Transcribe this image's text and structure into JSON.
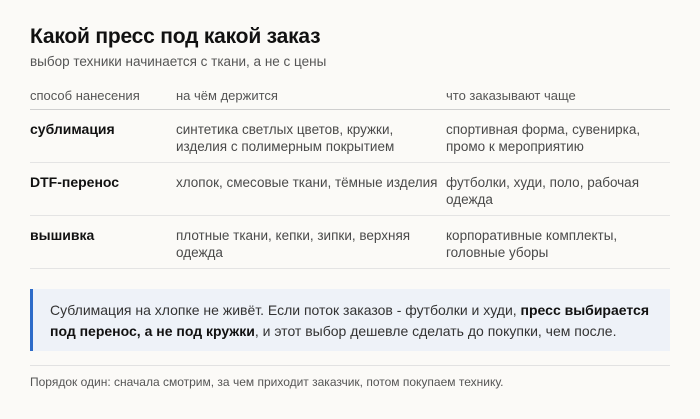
{
  "header": {
    "title": "Какой пресс под какой заказ",
    "subtitle": "выбор техники начинается с ткани, а не с цены"
  },
  "table": {
    "columns": [
      "способ нанесения",
      "на чём держится",
      "что заказывают чаще"
    ],
    "rows": [
      {
        "method": "сублимация",
        "works_on": "синтетика светлых цветов, кружки, изделия с полимерным покрытием",
        "ordered": "спортивная форма, сувенирка, промо к мероприятию"
      },
      {
        "method": "DTF-перенос",
        "works_on": "хлопок, смесовые ткани, тёмные изделия",
        "ordered": "футболки, худи, поло, рабочая одежда"
      },
      {
        "method": "вышивка",
        "works_on": "плотные ткани, кепки, зипки, верхняя одежда",
        "ordered": "корпоративные комплекты, головные уборы"
      }
    ]
  },
  "callout": {
    "text_before": "Сублимация на хлопке не живёт. Если поток заказов - футболки и худи, ",
    "text_bold": "пресс выбирается под перенос, а не под кружки",
    "text_after": ", и этот выбор дешевле сделать до покупки, чем после.",
    "accent_color": "#2d6bc8"
  },
  "footer": {
    "text": "Порядок один: сначала смотрим, за чем приходит заказчик, потом покупаем технику."
  }
}
